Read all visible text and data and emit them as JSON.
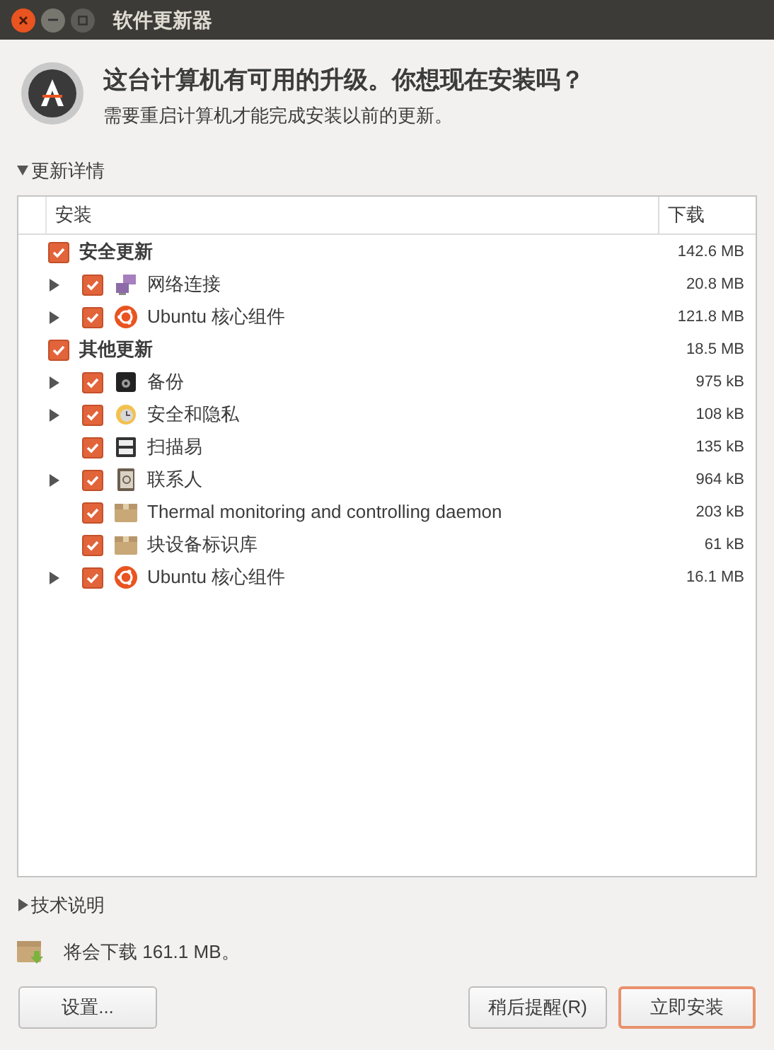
{
  "window": {
    "title": "软件更新器"
  },
  "header": {
    "title": "这台计算机有可用的升级。你想现在安装吗？",
    "subtitle": "需要重启计算机才能完成安装以前的更新。"
  },
  "details": {
    "label": "更新详情",
    "expanded": true
  },
  "table": {
    "columns": [
      "安装",
      "下载"
    ],
    "groups": [
      {
        "name": "安全更新",
        "checked": true,
        "size": "142.6 MB",
        "children": [
          {
            "name": "网络连接",
            "kind": "network",
            "checked": true,
            "expander": true,
            "size": "20.8 MB"
          },
          {
            "name": "Ubuntu 核心组件",
            "kind": "ubuntu",
            "checked": true,
            "expander": true,
            "size": "121.8 MB"
          }
        ]
      },
      {
        "name": "其他更新",
        "checked": true,
        "size": "18.5 MB",
        "children": [
          {
            "name": "备份",
            "kind": "backup",
            "checked": true,
            "expander": true,
            "size": "975 kB"
          },
          {
            "name": "安全和隐私",
            "kind": "security",
            "checked": true,
            "expander": true,
            "size": "108 kB"
          },
          {
            "name": "扫描易",
            "kind": "scanner",
            "checked": true,
            "expander": false,
            "size": "135 kB"
          },
          {
            "name": "联系人",
            "kind": "contacts",
            "checked": true,
            "expander": true,
            "size": "964 kB"
          },
          {
            "name": "Thermal monitoring and controlling daemon",
            "kind": "package",
            "checked": true,
            "expander": false,
            "size": "203 kB"
          },
          {
            "name": "块设备标识库",
            "kind": "package",
            "checked": true,
            "expander": false,
            "size": "61 kB"
          },
          {
            "name": "Ubuntu 核心组件",
            "kind": "ubuntu",
            "checked": true,
            "expander": true,
            "size": "16.1 MB"
          }
        ]
      }
    ]
  },
  "technical": {
    "label": "技术说明",
    "expanded": false
  },
  "download_note": "将会下载 161.1 MB。",
  "buttons": {
    "settings": "设置...",
    "remind": "稍后提醒(R)",
    "install": "立即安装"
  }
}
